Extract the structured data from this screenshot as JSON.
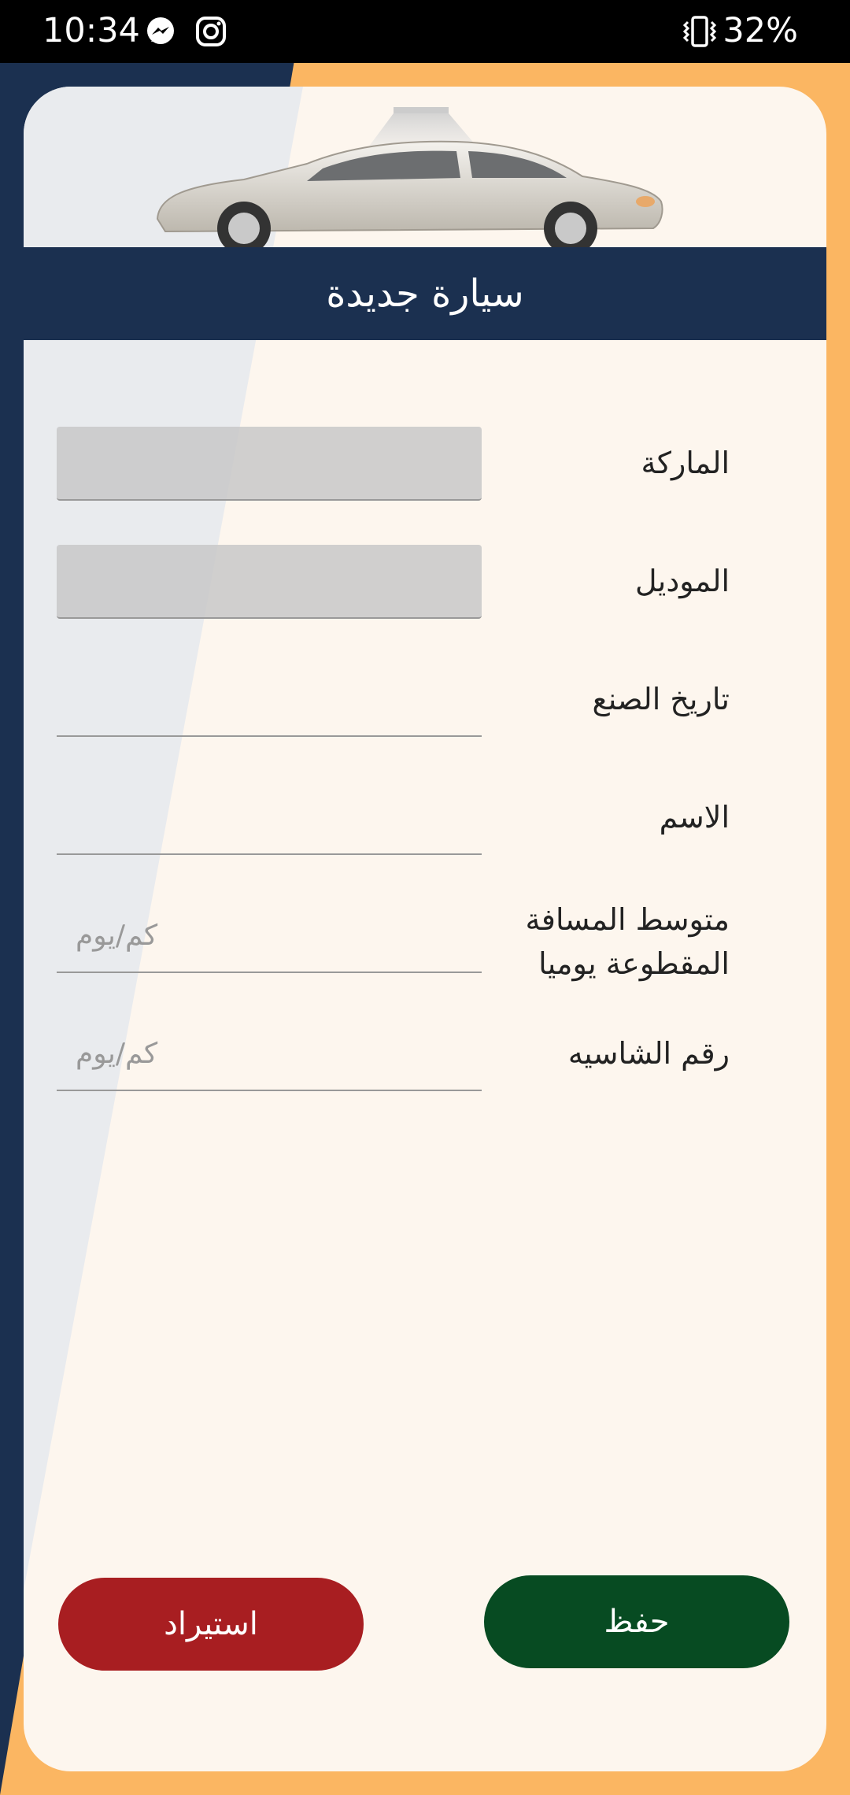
{
  "status_bar": {
    "time": "10:34",
    "battery": "32%"
  },
  "header": {
    "title": "سيارة جديدة"
  },
  "form": {
    "brand": {
      "label": "الماركة",
      "value": ""
    },
    "model": {
      "label": "الموديل",
      "value": ""
    },
    "manufacture_date": {
      "label": "تاريخ الصنع",
      "value": ""
    },
    "name": {
      "label": "الاسم",
      "value": ""
    },
    "avg_distance": {
      "label_line1": "متوسط المسافة",
      "label_line2": "المقطوعة يوميا",
      "placeholder": "كم/يوم"
    },
    "chassis_number": {
      "label": "رقم الشاسيه",
      "placeholder": "كم/يوم"
    }
  },
  "buttons": {
    "import_label": "استيراد",
    "save_label": "حفظ"
  },
  "colors": {
    "navy": "#1b3050",
    "orange": "#fbb662",
    "import": "#a81e21",
    "save": "#074b22"
  }
}
